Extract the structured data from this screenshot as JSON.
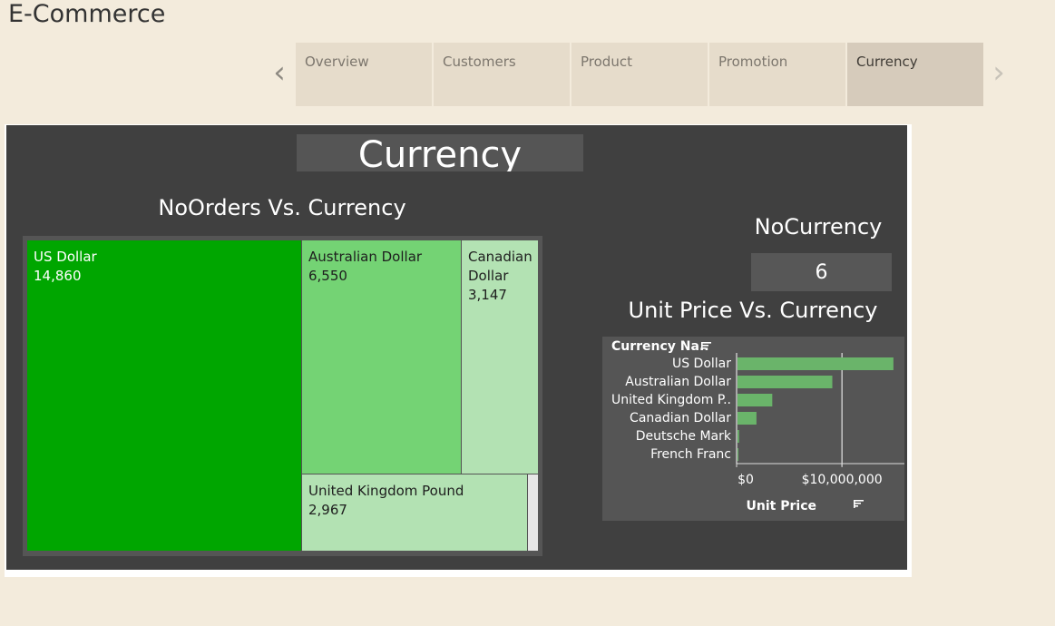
{
  "app": {
    "title": "E-Commerce"
  },
  "nav": {
    "prev_icon": "chevron-left-icon",
    "next_icon": "chevron-right-icon",
    "tabs": [
      {
        "label": "Overview",
        "active": false
      },
      {
        "label": "Customers",
        "active": false
      },
      {
        "label": "Product",
        "active": false
      },
      {
        "label": "Promotion",
        "active": false
      },
      {
        "label": "Currency",
        "active": true
      }
    ]
  },
  "dashboard": {
    "title": "Currency",
    "treemap": {
      "title": "NoOrders Vs. Currency",
      "tiles": [
        {
          "name": "US Dollar",
          "value": "14,860",
          "color": "#00a600"
        },
        {
          "name": "Australian Dollar",
          "value": "6,550",
          "color": "#74d374"
        },
        {
          "name": "Canadian Dollar",
          "value": "3,147",
          "color": "#b3e2b3"
        },
        {
          "name": "United Kingdom Pound",
          "value": "2,967",
          "color": "#b3e2b3"
        }
      ]
    },
    "kpi": {
      "title": "NoCurrency",
      "value": "6"
    },
    "bar_chart": {
      "title": "Unit Price Vs. Currency",
      "category_header": "Currency Na..",
      "axis_title": "Unit Price",
      "sort_icon": "sort-icon"
    }
  },
  "chart_data": {
    "type": "bar",
    "orientation": "horizontal",
    "categories": [
      "US Dollar",
      "Australian Dollar",
      "United Kingdom P..",
      "Canadian Dollar",
      "Deutsche Mark",
      "French Franc"
    ],
    "values": [
      14800000,
      9000000,
      3300000,
      1800000,
      150000,
      80000
    ],
    "xlim": [
      0,
      15500000
    ],
    "xticks": [
      0,
      10000000
    ],
    "xtick_labels": [
      "$0",
      "$10,000,000"
    ],
    "xlabel": "Unit Price",
    "bar_color": "#6ab46a",
    "grid": false
  }
}
